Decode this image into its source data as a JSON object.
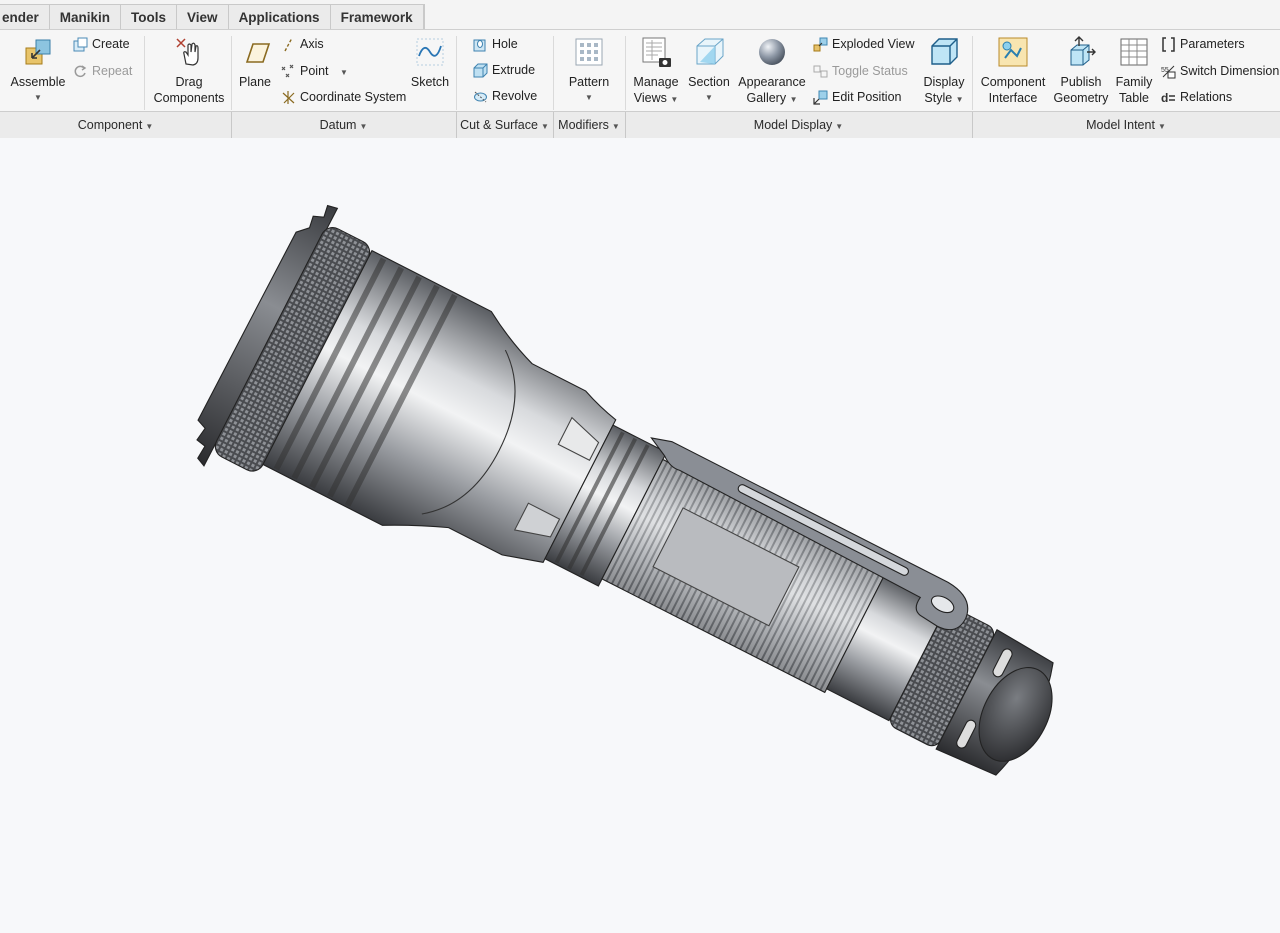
{
  "tabs": [
    "ender",
    "Manikin",
    "Tools",
    "View",
    "Applications",
    "Framework"
  ],
  "component": {
    "assemble": "Assemble",
    "create": "Create",
    "repeat": "Repeat",
    "drag": "Drag",
    "drag2": "Components",
    "group": "Component"
  },
  "datum": {
    "plane": "Plane",
    "axis": "Axis",
    "point": "Point",
    "csys": "Coordinate System",
    "sketch": "Sketch",
    "group": "Datum"
  },
  "cut": {
    "hole": "Hole",
    "extrude": "Extrude",
    "revolve": "Revolve",
    "group": "Cut & Surface"
  },
  "modifiers": {
    "pattern": "Pattern",
    "group": "Modifiers"
  },
  "display": {
    "manage1": "Manage",
    "manage2": "Views",
    "section": "Section",
    "appear1": "Appearance",
    "appear2": "Gallery",
    "exploded": "Exploded View",
    "toggle": "Toggle Status",
    "editpos": "Edit Position",
    "dstyle1": "Display",
    "dstyle2": "Style",
    "group": "Model Display"
  },
  "intent": {
    "ci1": "Component",
    "ci2": "Interface",
    "pg1": "Publish",
    "pg2": "Geometry",
    "ft1": "Family",
    "ft2": "Table",
    "params": "Parameters",
    "switch": "Switch Dimension",
    "relations": "Relations",
    "group": "Model Intent"
  },
  "icons": [
    "assemble-icon",
    "create-icon",
    "repeat-icon",
    "drag-components-icon",
    "plane-icon",
    "axis-icon",
    "point-icon",
    "coordinate-system-icon",
    "sketch-icon",
    "hole-icon",
    "extrude-icon",
    "revolve-icon",
    "pattern-icon",
    "manage-views-icon",
    "section-icon",
    "appearance-gallery-icon",
    "exploded-view-icon",
    "toggle-status-icon",
    "edit-position-icon",
    "display-style-icon",
    "component-interface-icon",
    "publish-geometry-icon",
    "family-table-icon",
    "parameters-icon",
    "switch-dimension-icon",
    "relations-icon"
  ]
}
